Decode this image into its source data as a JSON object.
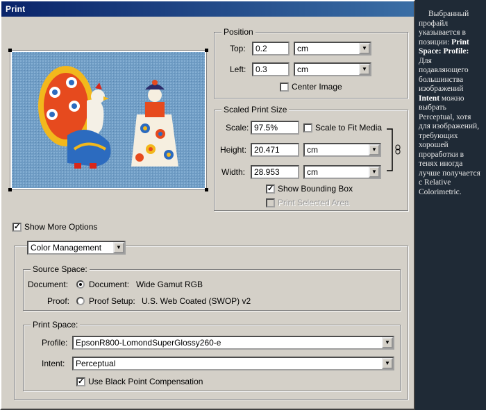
{
  "window": {
    "title": "Print"
  },
  "position": {
    "legend": "Position",
    "top_label": "Top:",
    "top_value": "0.2",
    "top_unit": "cm",
    "left_label": "Left:",
    "left_value": "0.3",
    "left_unit": "cm",
    "center_image_label": "Center Image",
    "center_image_checked": false
  },
  "scaled": {
    "legend": "Scaled Print Size",
    "scale_label": "Scale:",
    "scale_value": "97.5%",
    "scale_to_fit_label": "Scale to Fit Media",
    "scale_to_fit_checked": false,
    "height_label": "Height:",
    "height_value": "20.471",
    "height_unit": "cm",
    "width_label": "Width:",
    "width_value": "28.953",
    "width_unit": "cm",
    "show_bbox_label": "Show Bounding Box",
    "show_bbox_checked": true,
    "print_selected_label": "Print Selected Area",
    "print_selected_checked": false
  },
  "more_options": {
    "label": "Show More Options",
    "checked": true
  },
  "color_mgmt": {
    "dropdown_value": "Color Management",
    "source": {
      "legend": "Source Space:",
      "document_label": "Document:",
      "document_option": "Document:",
      "document_value": "Wide Gamut RGB",
      "proof_label": "Proof:",
      "proof_option": "Proof Setup:",
      "proof_value": "U.S. Web Coated (SWOP) v2"
    },
    "print": {
      "legend": "Print Space:",
      "profile_label": "Profile:",
      "profile_value": "EpsonR800-LomondSuperGlossy260-e",
      "intent_label": "Intent:",
      "intent_value": "Perceptual",
      "bpc_label": "Use Black Point Compensation",
      "bpc_checked": true
    }
  },
  "sidebar": {
    "parts": [
      "Выбранный профайл указывается в позиции: ",
      "Print Space: Profile:",
      " Для подавляющего большинства изображений ",
      "Intent",
      " можно выбрать Perceptual, хотя для изображений, требующих хорошей проработки в тенях иногда лучше получается с Relative Colorimetric."
    ]
  },
  "colors": {
    "title_bar": "#0a246a",
    "dialog_bg": "#d4d0c8",
    "page_bg": "#1f2a36"
  },
  "icons": {
    "dropdown": "chevron-down-icon",
    "link": "chain-link-icon"
  }
}
